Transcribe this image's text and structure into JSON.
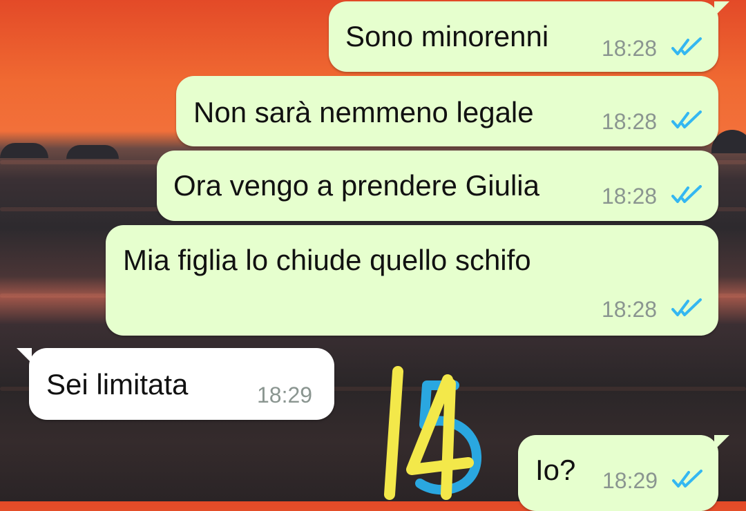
{
  "chat": {
    "messages": [
      {
        "direction": "outgoing",
        "text": "Sono minorenni",
        "time": "18:28",
        "status": "read"
      },
      {
        "direction": "outgoing",
        "text": "Non sarà nemmeno legale",
        "time": "18:28",
        "status": "read"
      },
      {
        "direction": "outgoing",
        "text": "Ora vengo a prendere Giulia",
        "time": "18:28",
        "status": "read"
      },
      {
        "direction": "outgoing",
        "text": "Mia figlia lo chiude quello schifo",
        "time": "18:28",
        "status": "read"
      },
      {
        "direction": "incoming",
        "text": "Sei limitata",
        "time": "18:29"
      },
      {
        "direction": "outgoing",
        "text": "Io?",
        "time": "18:29",
        "status": "read"
      }
    ],
    "annotation_marks": [
      "14",
      "5"
    ],
    "colors": {
      "outgoing_bubble": "#e6ffce",
      "incoming_bubble": "#ffffff",
      "read_ticks": "#34b7f1",
      "timestamp": "#8a9590",
      "annotation_yellow": "#f3e84a",
      "annotation_blue": "#2aa7e0"
    }
  }
}
